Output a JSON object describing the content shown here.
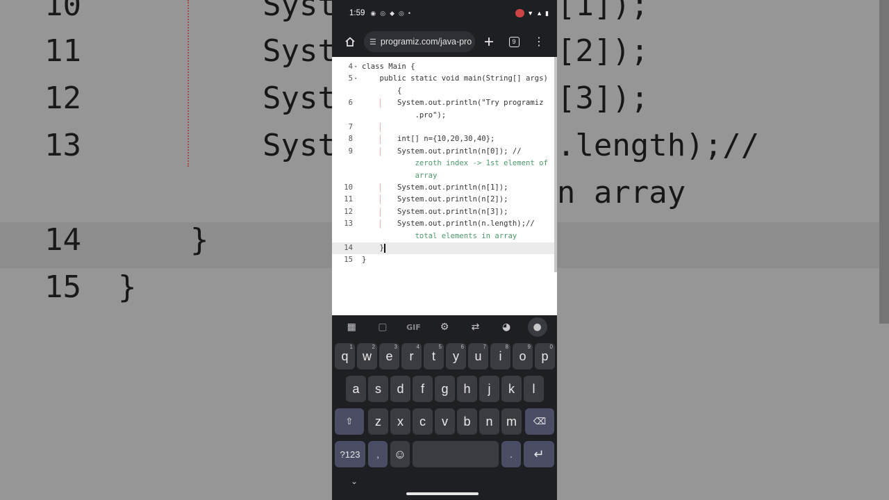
{
  "status_bar": {
    "time": "1:59",
    "left_icons": [
      "chrome-icon",
      "whatsapp-icon",
      "messenger-icon",
      "whatsapp-icon",
      "dot-icon"
    ],
    "right_icons": [
      "record-icon",
      "wifi-icon",
      "signal-icon",
      "battery-icon"
    ]
  },
  "browser": {
    "url": "programiz.com/java-pro",
    "tab_count": "9"
  },
  "editor": {
    "lines": [
      {
        "num": "4",
        "fold": "▾",
        "code": "class Main {"
      },
      {
        "num": "5",
        "fold": "▾",
        "code": "    public static void main(String[] args)"
      },
      {
        "num": "",
        "fold": "",
        "code": "        {"
      },
      {
        "num": "6",
        "fold": "",
        "code": "        System.out.println(\"Try programiz"
      },
      {
        "num": "",
        "fold": "",
        "code": "            .pro\");"
      },
      {
        "num": "7",
        "fold": "",
        "code": ""
      },
      {
        "num": "8",
        "fold": "",
        "code": "        int[] n={10,20,30,40};"
      },
      {
        "num": "9",
        "fold": "",
        "code": "        System.out.println(n[0]); //"
      },
      {
        "num": "",
        "fold": "",
        "code": "            zeroth index -> 1st element of"
      },
      {
        "num": "",
        "fold": "",
        "code": "            array"
      },
      {
        "num": "10",
        "fold": "",
        "code": "        System.out.println(n[1]);"
      },
      {
        "num": "11",
        "fold": "",
        "code": "        System.out.println(n[2]);"
      },
      {
        "num": "12",
        "fold": "",
        "code": "        System.out.println(n[3]);"
      },
      {
        "num": "13",
        "fold": "",
        "code": "        System.out.println(n.length);//"
      },
      {
        "num": "",
        "fold": "",
        "code": "            total elements in array"
      },
      {
        "num": "14",
        "fold": "",
        "code": "    }"
      },
      {
        "num": "15",
        "fold": "",
        "code": "}"
      }
    ]
  },
  "background": {
    "lines": [
      {
        "num": "10",
        "code": "Syst        ln(n[1]);"
      },
      {
        "num": "11",
        "code": "Syst        ln(n[2]);"
      },
      {
        "num": "12",
        "code": "Syst        ln(n[3]);"
      },
      {
        "num": "13",
        "code": "Syst        ln(n.length);//"
      },
      {
        "num": "",
        "code": "            ts in array"
      },
      {
        "num": "14",
        "code": "}"
      },
      {
        "num": "15",
        "code": "}"
      }
    ]
  },
  "keyboard": {
    "tools": [
      "apps-icon",
      "sticker-icon",
      "GIF",
      "settings-icon",
      "translate-icon",
      "palette-icon",
      "mic-icon"
    ],
    "row1": [
      {
        "k": "q",
        "h": "1"
      },
      {
        "k": "w",
        "h": "2"
      },
      {
        "k": "e",
        "h": "3"
      },
      {
        "k": "r",
        "h": "4"
      },
      {
        "k": "t",
        "h": "5"
      },
      {
        "k": "y",
        "h": "6"
      },
      {
        "k": "u",
        "h": "7"
      },
      {
        "k": "i",
        "h": "8"
      },
      {
        "k": "o",
        "h": "9"
      },
      {
        "k": "p",
        "h": "0"
      }
    ],
    "row2": [
      "a",
      "s",
      "d",
      "f",
      "g",
      "h",
      "j",
      "k",
      "l"
    ],
    "row3": [
      "z",
      "x",
      "c",
      "v",
      "b",
      "n",
      "m"
    ],
    "shift": "⇧",
    "backspace": "⌫",
    "symbols": "?123",
    "comma": ",",
    "emoji": "☺",
    "period": ".",
    "enter": "↵",
    "hide": "⌄"
  }
}
